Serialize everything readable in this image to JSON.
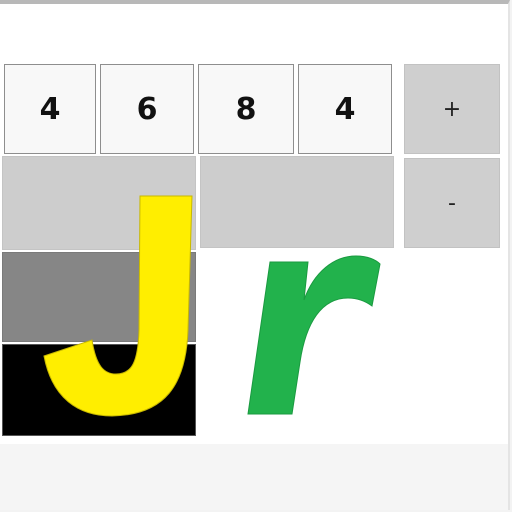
{
  "display": {
    "digits": [
      "4",
      "6",
      "8",
      "4"
    ]
  },
  "controls": {
    "increment_label": "+",
    "decrement_label": "-"
  },
  "colors": {
    "logo_j": "#ffee00",
    "logo_r": "#22b24c",
    "panel_light": "#cdcdcd",
    "panel_mid": "#868686",
    "panel_dark": "#000000"
  },
  "icons": {
    "logo": "jr-letters-logo"
  }
}
